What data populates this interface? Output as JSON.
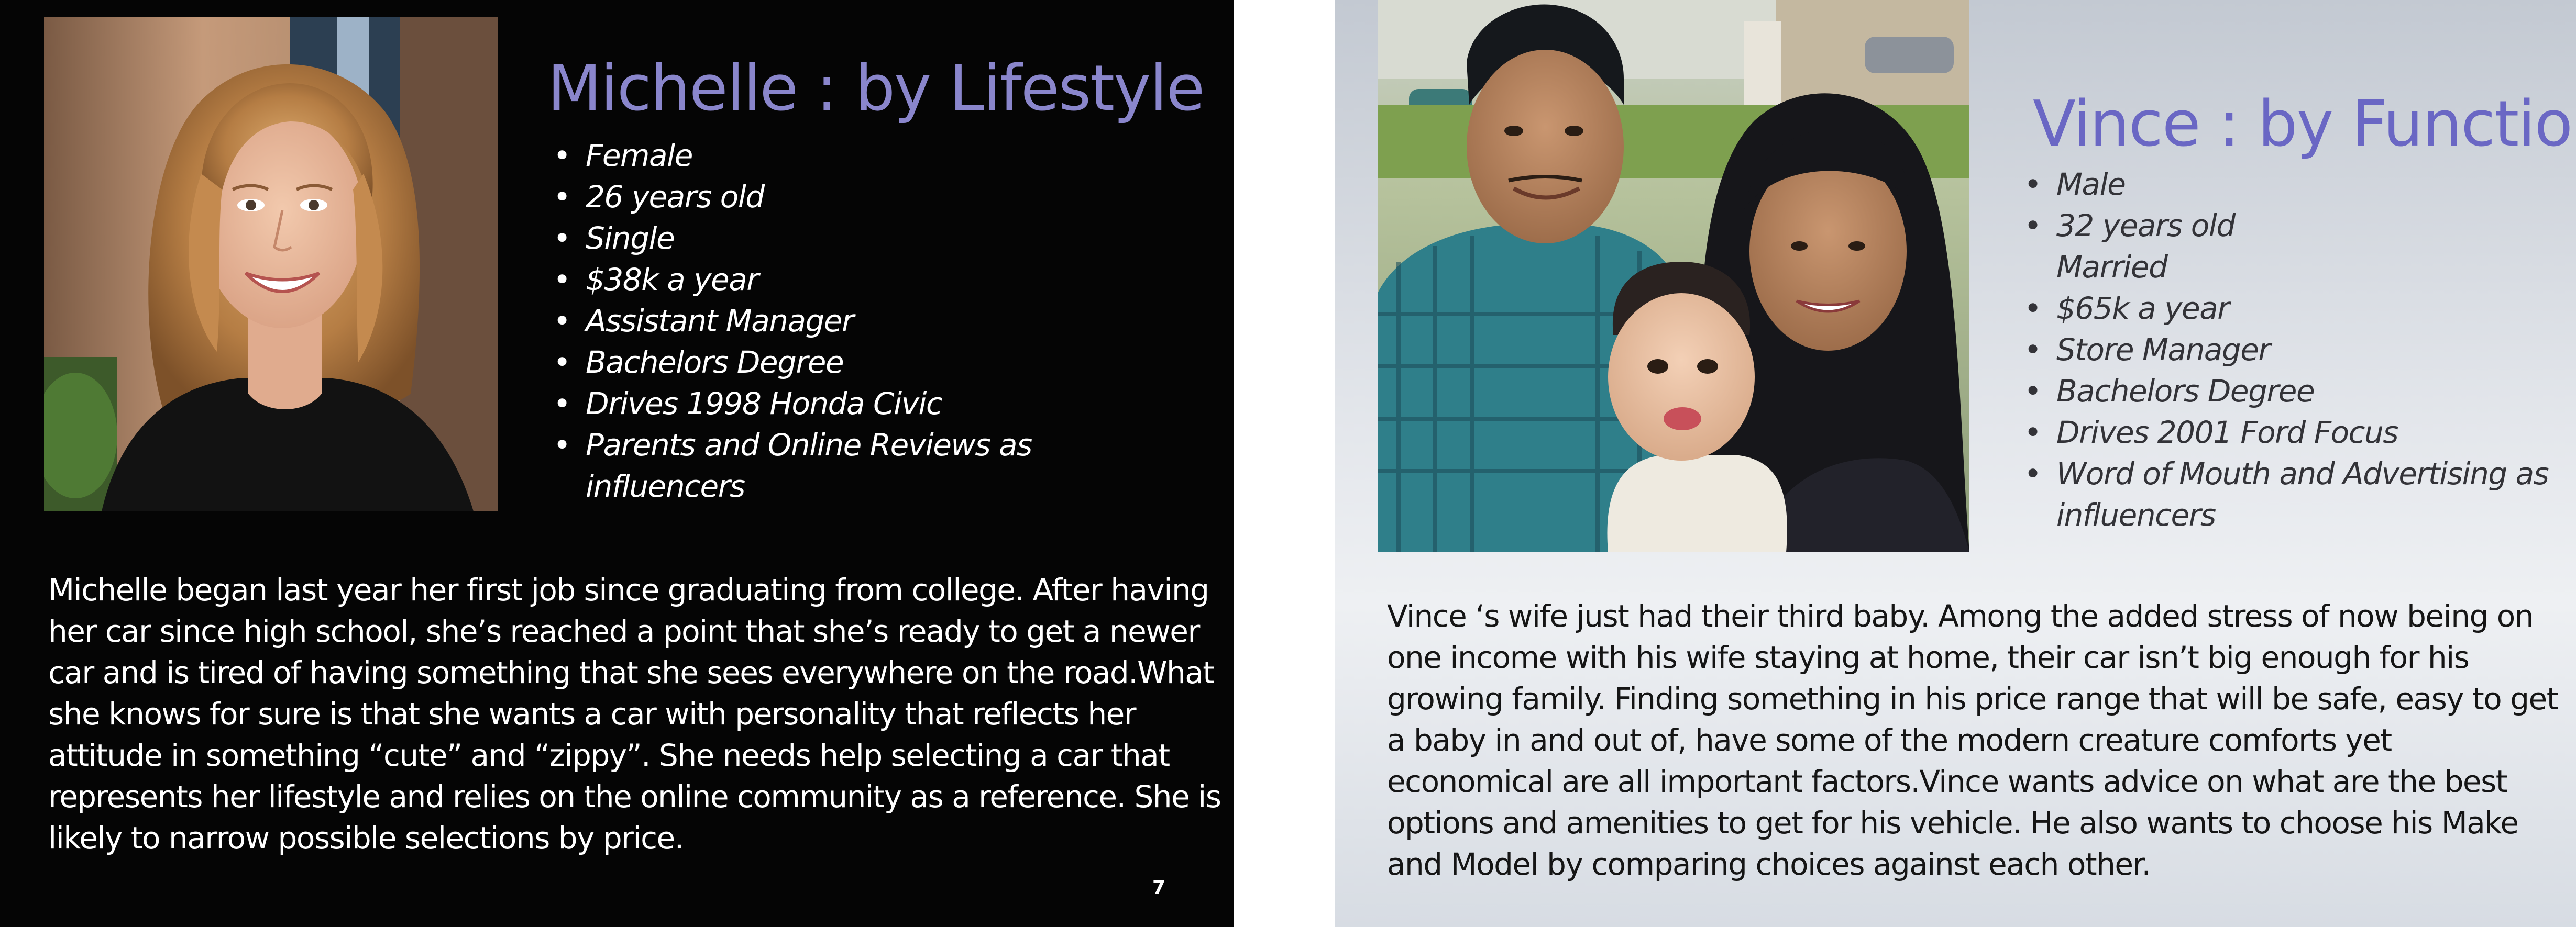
{
  "slide1": {
    "title": "Michelle : by Lifestyle",
    "bullets": [
      "Female",
      "26 years old",
      "Single",
      "$38k a year",
      "Assistant Manager",
      "Bachelors Degree",
      "Drives 1998 Honda Civic",
      "Parents and Online Reviews as influencers"
    ],
    "story": "Michelle began last year her first job since graduating from college. After having her car since high school, she’s reached a point that she’s ready to get a newer car and is tired of having something that she sees everywhere on the road.What she knows for sure is that she wants a car with personality that reflects her attitude in something “cute” and “zippy”. She needs help selecting a car that represents her lifestyle and relies on the online community as a reference. She is likely to narrow possible selections by price.",
    "page_number": "7"
  },
  "slide2": {
    "title": "Vince : by Function",
    "bullets": [
      "Male",
      "32 years old",
      "Married",
      "$65k a year",
      "Store Manager",
      "Bachelors Degree",
      "Drives 2001 Ford Focus",
      "Word of Mouth and Advertising as influencers"
    ],
    "story": "Vince ‘s wife just had their third baby.  Among the added stress of now being on one income with his wife staying at home, their car isn’t big enough for his growing family. Finding something in his price range that will be safe, easy to get a baby in and out of, have some of the modern creature comforts yet economical are all important factors.Vince wants advice on what are the best options and amenities to get for his vehicle. He also wants to choose his Make and Model by comparing choices against each other."
  },
  "colors": {
    "slide1_background": "#050505",
    "slide1_title": "#8a86cc",
    "slide2_title": "#6a67c4",
    "slide2_text": "#333338"
  },
  "images": [
    "photo-smiling-woman",
    "photo-family-with-baby"
  ]
}
